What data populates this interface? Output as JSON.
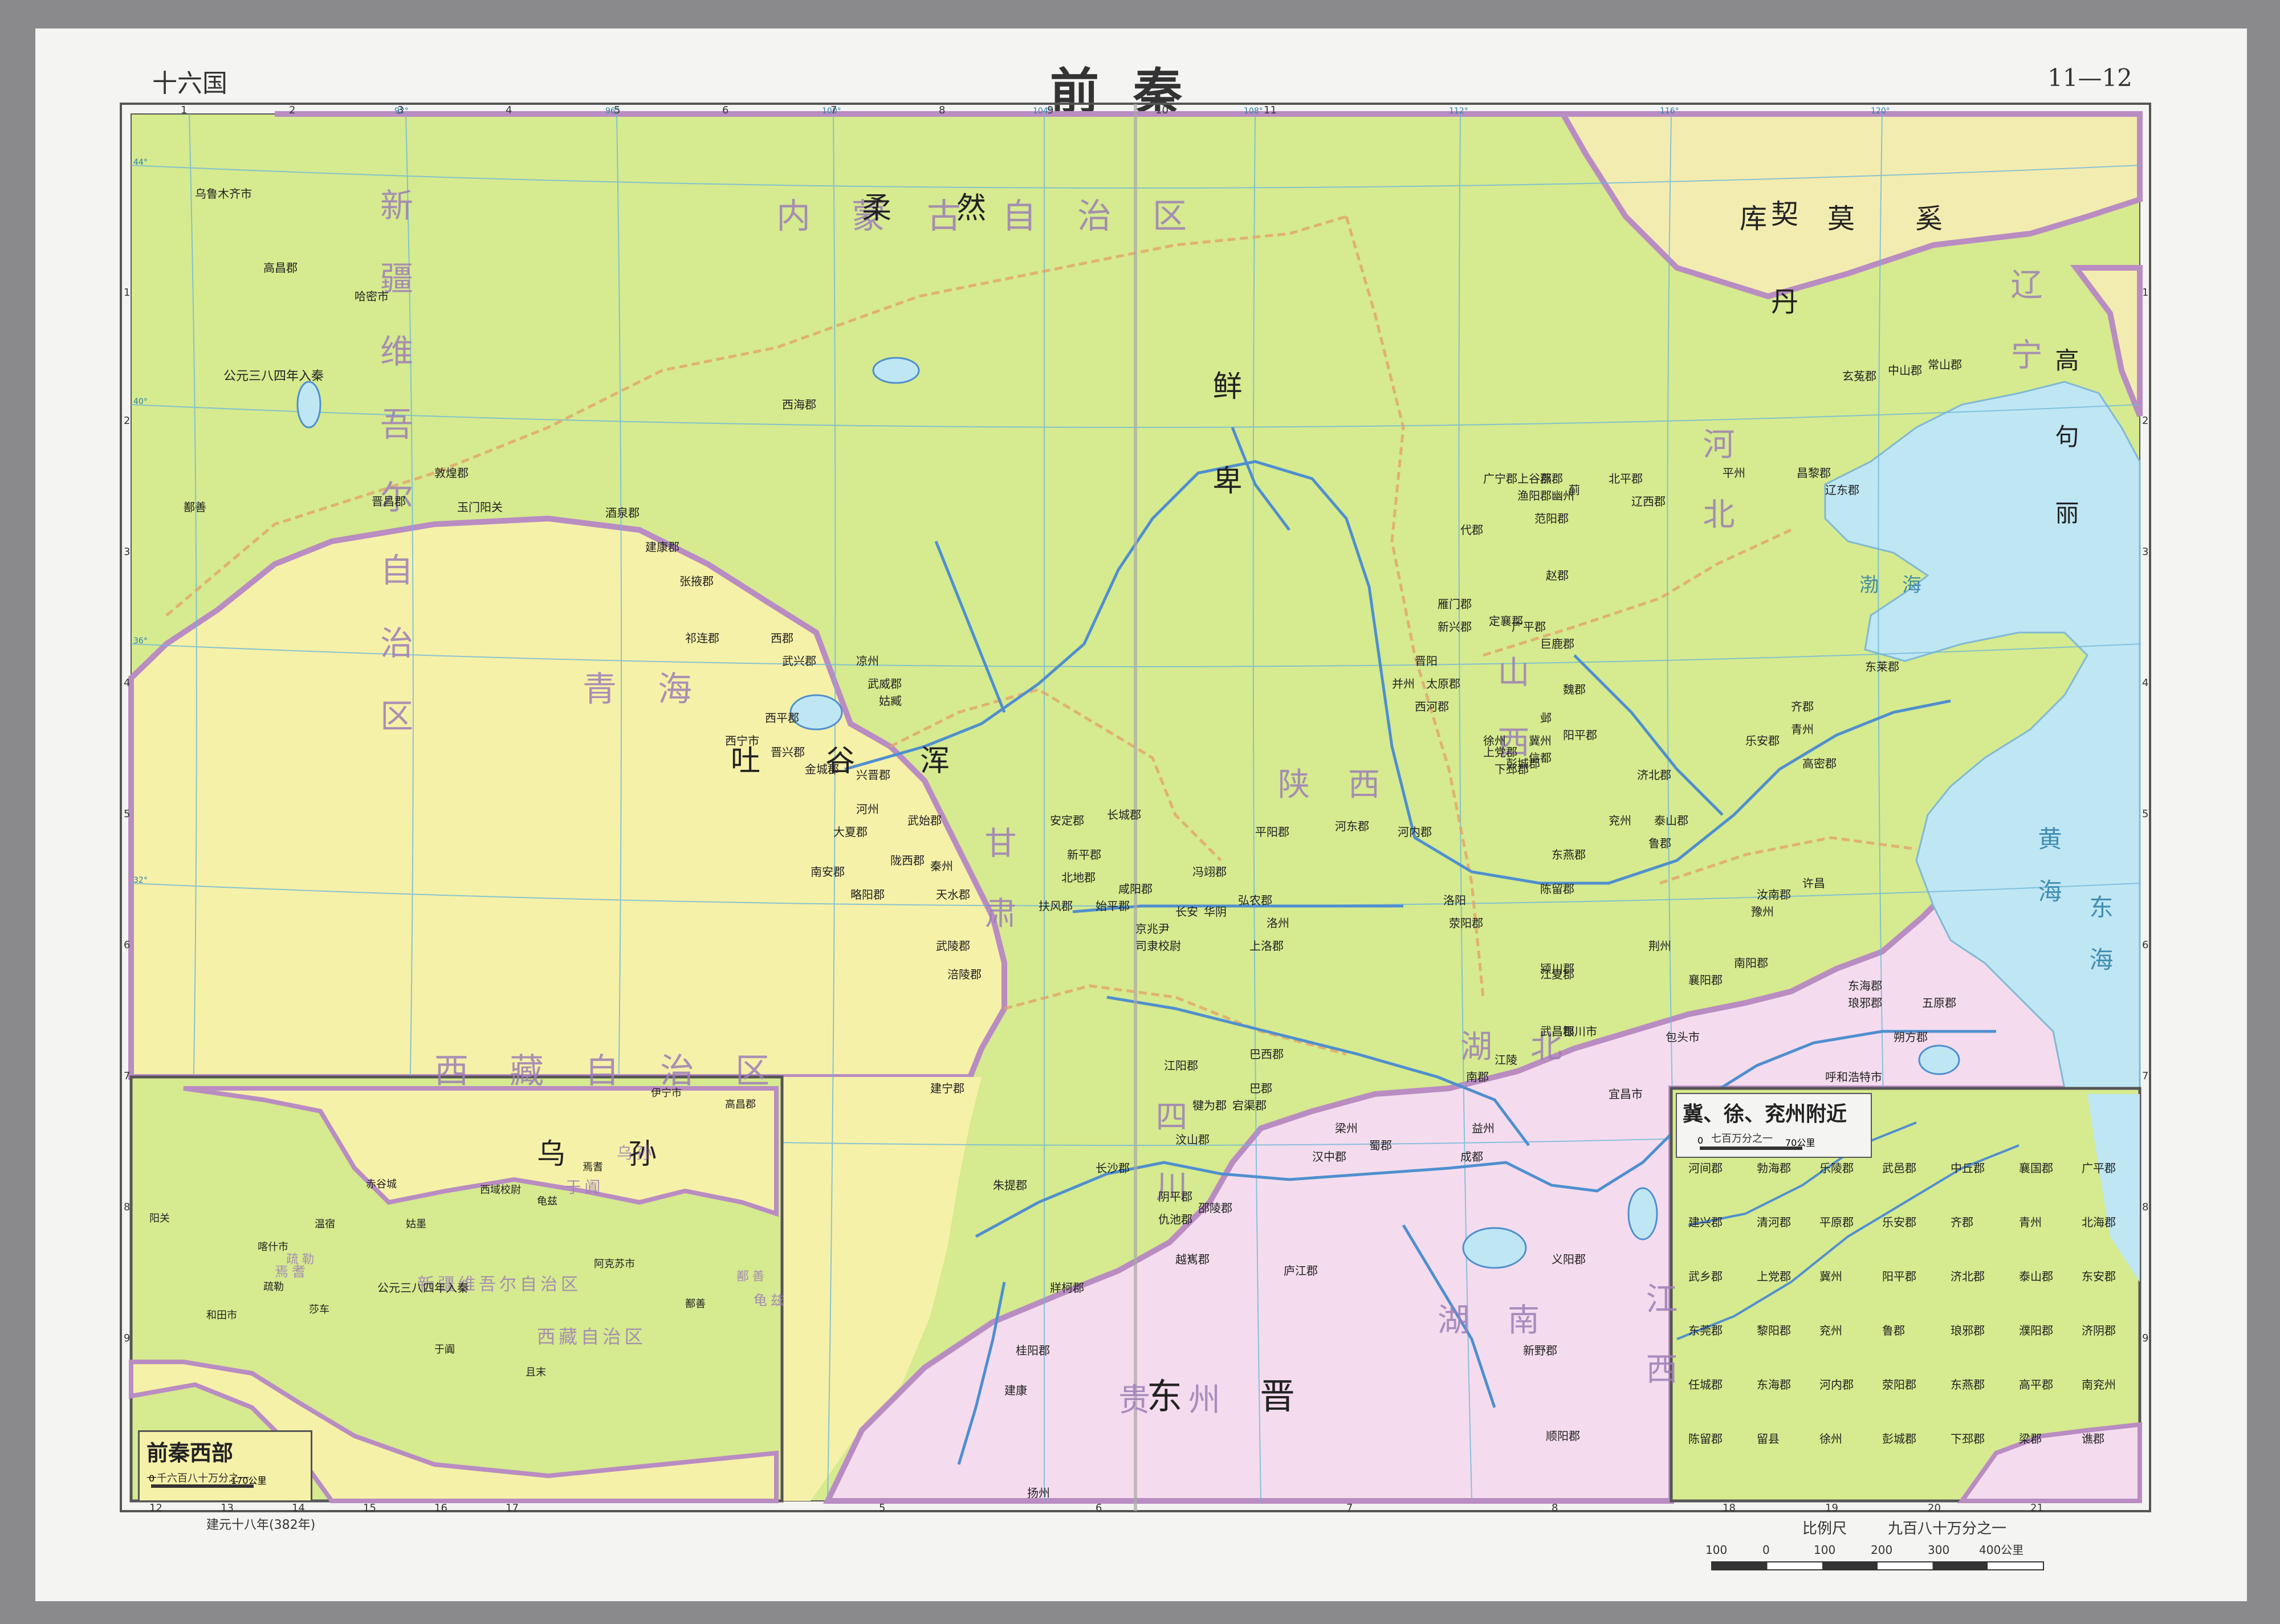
{
  "header": {
    "series": "十六国",
    "title": "前秦",
    "page_no": "11—12"
  },
  "footer": {
    "date": "建元十八年(382年)",
    "scale_label": "比例尺",
    "scale_ratio": "九百八十万分之一",
    "scale_ticks": [
      "100",
      "0",
      "100",
      "200",
      "300",
      "400公里"
    ]
  },
  "grid": {
    "columns_top": [
      "1",
      "2",
      "3",
      "4",
      "5",
      "6",
      "7",
      "8",
      "9",
      "10",
      "11"
    ],
    "columns_bottom": [
      "12",
      "13",
      "14",
      "15",
      "16",
      "17",
      "5",
      "6",
      "7",
      "8",
      "18",
      "19",
      "20",
      "21"
    ],
    "rows": [
      "1",
      "2",
      "3",
      "4",
      "5",
      "6",
      "7",
      "8",
      "9"
    ],
    "meridians": [
      "92°",
      "96°",
      "100°",
      "104°",
      "108°",
      "112°",
      "116°",
      "120°"
    ],
    "parallels": [
      "44°",
      "40°",
      "36°",
      "32°"
    ]
  },
  "regions": [
    {
      "text": "新疆维吾尔自治区"
    },
    {
      "text": "内蒙古自治区"
    },
    {
      "text": "青海"
    },
    {
      "text": "甘肃"
    },
    {
      "text": "西藏自治区"
    },
    {
      "text": "四川"
    },
    {
      "text": "陕西"
    },
    {
      "text": "山西"
    },
    {
      "text": "河北"
    },
    {
      "text": "辽宁"
    },
    {
      "text": "湖北"
    },
    {
      "text": "湖南"
    },
    {
      "text": "贵州"
    },
    {
      "text": "江西"
    },
    {
      "text": "渤海"
    },
    {
      "text": "黄海"
    },
    {
      "text": "东海"
    }
  ],
  "polities": [
    {
      "text": "柔然"
    },
    {
      "text": "鲜卑"
    },
    {
      "text": "库莫奚"
    },
    {
      "text": "契丹"
    },
    {
      "text": "高句丽"
    },
    {
      "text": "吐谷浑"
    },
    {
      "text": "东晋"
    },
    {
      "text": "乌孙"
    }
  ],
  "annotations": [
    {
      "text": "公元三八四年入秦"
    }
  ],
  "places": [
    {
      "name": "乌鲁木齐市"
    },
    {
      "name": "高昌郡"
    },
    {
      "name": "哈密市"
    },
    {
      "name": "敦煌郡"
    },
    {
      "name": "玉门"
    },
    {
      "name": "阳关"
    },
    {
      "name": "晋昌郡"
    },
    {
      "name": "鄯善"
    },
    {
      "name": "酒泉郡"
    },
    {
      "name": "建康郡"
    },
    {
      "name": "张掖郡"
    },
    {
      "name": "西海郡"
    },
    {
      "name": "祁连郡"
    },
    {
      "name": "西郡"
    },
    {
      "name": "武兴郡"
    },
    {
      "name": "凉州"
    },
    {
      "name": "武威郡"
    },
    {
      "name": "姑臧"
    },
    {
      "name": "西平郡"
    },
    {
      "name": "西宁市"
    },
    {
      "name": "晋兴郡"
    },
    {
      "name": "金城郡"
    },
    {
      "name": "河州"
    },
    {
      "name": "兴晋郡"
    },
    {
      "name": "大夏郡"
    },
    {
      "name": "武始郡"
    },
    {
      "name": "陇西郡"
    },
    {
      "name": "南安郡"
    },
    {
      "name": "秦州"
    },
    {
      "name": "天水郡"
    },
    {
      "name": "略阳郡"
    },
    {
      "name": "安定郡"
    },
    {
      "name": "新平郡"
    },
    {
      "name": "北地郡"
    },
    {
      "name": "长城郡"
    },
    {
      "name": "扶风郡"
    },
    {
      "name": "始平郡"
    },
    {
      "name": "咸阳郡"
    },
    {
      "name": "长安"
    },
    {
      "name": "京兆尹"
    },
    {
      "name": "司隶校尉"
    },
    {
      "name": "冯翊郡"
    },
    {
      "name": "华阴"
    },
    {
      "name": "弘农郡"
    },
    {
      "name": "洛州"
    },
    {
      "name": "上洛郡"
    },
    {
      "name": "平阳郡"
    },
    {
      "name": "河东郡"
    },
    {
      "name": "河内郡"
    },
    {
      "name": "洛阳"
    },
    {
      "name": "荥阳郡"
    },
    {
      "name": "陈留郡"
    },
    {
      "name": "颍川郡"
    },
    {
      "name": "东燕郡"
    },
    {
      "name": "兖州"
    },
    {
      "name": "济北郡"
    },
    {
      "name": "泰山郡"
    },
    {
      "name": "鲁郡"
    },
    {
      "name": "青州"
    },
    {
      "name": "齐郡"
    },
    {
      "name": "高密郡"
    },
    {
      "name": "东莱郡"
    },
    {
      "name": "乐安郡"
    },
    {
      "name": "冀州"
    },
    {
      "name": "信都"
    },
    {
      "name": "并州"
    },
    {
      "name": "晋阳"
    },
    {
      "name": "太原郡"
    },
    {
      "name": "上党郡"
    },
    {
      "name": "西河郡"
    },
    {
      "name": "雁门郡"
    },
    {
      "name": "新兴郡"
    },
    {
      "name": "定襄郡"
    },
    {
      "name": "代郡"
    },
    {
      "name": "广宁郡"
    },
    {
      "name": "上谷郡"
    },
    {
      "name": "幽州"
    },
    {
      "name": "蓟"
    },
    {
      "name": "燕郡"
    },
    {
      "name": "范阳郡"
    },
    {
      "name": "渔阳郡"
    },
    {
      "name": "北平郡"
    },
    {
      "name": "辽西郡"
    },
    {
      "name": "平州"
    },
    {
      "name": "昌黎郡"
    },
    {
      "name": "辽东郡"
    },
    {
      "name": "玄菟郡"
    },
    {
      "name": "中山郡"
    },
    {
      "name": "常山郡"
    },
    {
      "name": "赵郡"
    },
    {
      "name": "巨鹿郡"
    },
    {
      "name": "魏郡"
    },
    {
      "name": "邺"
    },
    {
      "name": "广平郡"
    },
    {
      "name": "阳平郡"
    },
    {
      "name": "徐州"
    },
    {
      "name": "彭城郡"
    },
    {
      "name": "下邳郡"
    },
    {
      "name": "东海郡"
    },
    {
      "name": "琅邪郡"
    },
    {
      "name": "豫州"
    },
    {
      "name": "汝南郡"
    },
    {
      "name": "许昌"
    },
    {
      "name": "南阳郡"
    },
    {
      "name": "襄阳郡"
    },
    {
      "name": "荆州"
    },
    {
      "name": "江夏郡"
    },
    {
      "name": "武昌郡"
    },
    {
      "name": "江陵"
    },
    {
      "name": "南郡"
    },
    {
      "name": "宜昌市"
    },
    {
      "name": "巴东郡"
    },
    {
      "name": "益州"
    },
    {
      "name": "成都"
    },
    {
      "name": "蜀郡"
    },
    {
      "name": "汉中郡"
    },
    {
      "name": "梁州"
    },
    {
      "name": "巴西郡"
    },
    {
      "name": "巴郡"
    },
    {
      "name": "宕渠郡"
    },
    {
      "name": "犍为郡"
    },
    {
      "name": "江阳郡"
    },
    {
      "name": "汶山郡"
    },
    {
      "name": "阴平郡"
    },
    {
      "name": "仇池郡"
    },
    {
      "name": "越嶲郡"
    },
    {
      "name": "牂柯郡"
    },
    {
      "name": "朱提郡"
    },
    {
      "name": "建宁郡"
    },
    {
      "name": "涪陵郡"
    },
    {
      "name": "武陵郡"
    },
    {
      "name": "长沙郡"
    },
    {
      "name": "邵陵郡"
    },
    {
      "name": "桂阳郡"
    },
    {
      "name": "建康"
    },
    {
      "name": "扬州"
    },
    {
      "name": "庐江郡"
    },
    {
      "name": "义阳郡"
    },
    {
      "name": "新野郡"
    },
    {
      "name": "顺阳郡"
    },
    {
      "name": "五原郡"
    },
    {
      "name": "朔方郡"
    },
    {
      "name": "呼和浩特市"
    },
    {
      "name": "包头市"
    },
    {
      "name": "银川市"
    }
  ],
  "insets": [
    {
      "title": "前秦西部",
      "scale_ratio": "一千六百八十万分之一",
      "scale_ticks": [
        "0",
        "170公里"
      ],
      "regions": [
        "新疆维吾尔自治区",
        "西藏自治区",
        "乌孙",
        "于阗",
        "焉耆",
        "龟兹",
        "疏勒",
        "鄯善"
      ],
      "places": [
        "伊宁市",
        "赤谷城",
        "温宿",
        "姑墨",
        "西域校尉",
        "龟兹",
        "焉耆",
        "高昌郡",
        "疏勒",
        "莎车",
        "于阗",
        "且末",
        "鄯善",
        "阳关",
        "阿克苏市",
        "喀什市",
        "和田市"
      ],
      "annotation": "公元三八四年入秦"
    },
    {
      "title": "冀、徐、兖州附近",
      "scale_ratio": "七百万分之一",
      "scale_ticks": [
        "0",
        "70公里"
      ],
      "places": [
        "河间郡",
        "勃海郡",
        "乐陵郡",
        "武邑郡",
        "中丘郡",
        "襄国郡",
        "广平郡",
        "建兴郡",
        "清河郡",
        "平原郡",
        "乐安郡",
        "齐郡",
        "青州",
        "北海郡",
        "武乡郡",
        "上党郡",
        "冀州",
        "阳平郡",
        "济北郡",
        "泰山郡",
        "东安郡",
        "东莞郡",
        "黎阳郡",
        "兖州",
        "鲁郡",
        "琅邪郡",
        "濮阳郡",
        "济阴郡",
        "任城郡",
        "东海郡",
        "河内郡",
        "荥阳郡",
        "东燕郡",
        "高平郡",
        "南兖州",
        "陈留郡",
        "留县",
        "徐州",
        "彭城郡",
        "下邳郡",
        "梁郡",
        "谯郡"
      ]
    }
  ],
  "colors": {
    "qin": "#d6ea8f",
    "tuyuhun": "#f6f1a8",
    "jin": "#f4dcee",
    "north": "#f3ecb0",
    "sea": "#bfe6f3",
    "border": "#b98cc2",
    "river": "#4f8fcf",
    "grid": "#6fb8d8"
  }
}
